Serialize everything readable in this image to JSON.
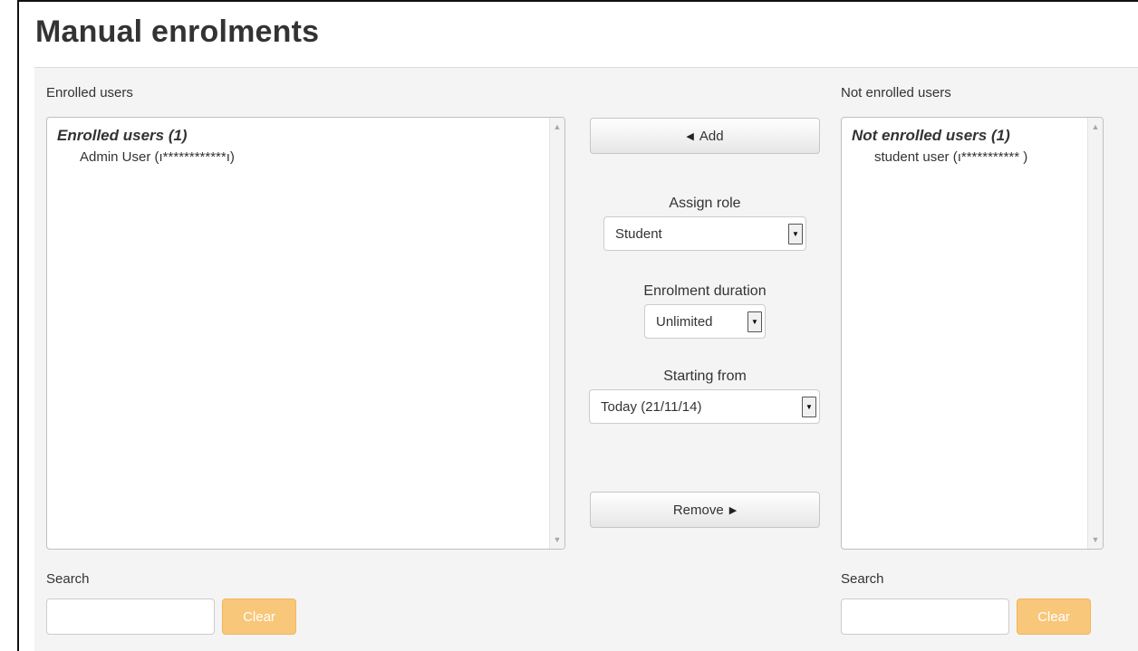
{
  "page": {
    "title": "Manual enrolments"
  },
  "enrolled": {
    "heading": "Enrolled users",
    "group_label": "Enrolled users (1)",
    "options": [
      "Admin User (ı************ı)"
    ]
  },
  "not_enrolled": {
    "heading": "Not enrolled users",
    "group_label": "Not enrolled users (1)",
    "options": [
      "student user (ı*********** )"
    ]
  },
  "actions": {
    "add_label": "Add",
    "add_icon": "left-triangle-icon",
    "remove_label": "Remove",
    "remove_icon": "right-triangle-icon"
  },
  "assign_role": {
    "label": "Assign role",
    "value": "Student"
  },
  "enrolment_duration": {
    "label": "Enrolment duration",
    "value": "Unlimited"
  },
  "starting_from": {
    "label": "Starting from",
    "value": "Today (21/11/14)"
  },
  "search_left": {
    "label": "Search",
    "value": "",
    "clear_label": "Clear"
  },
  "search_right": {
    "label": "Search",
    "value": "",
    "clear_label": "Clear"
  },
  "colors": {
    "clear_button": "#f8c77a",
    "panel_background": "#f4f4f4"
  }
}
